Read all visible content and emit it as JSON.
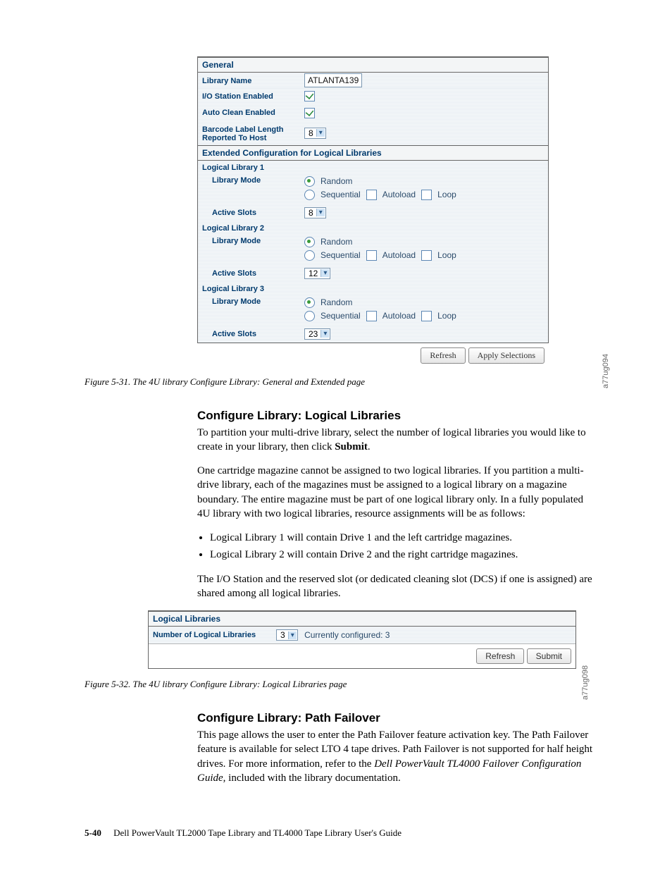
{
  "fig1": {
    "section_general": "General",
    "library_name_lbl": "Library Name",
    "library_name_val": "ATLANTA139",
    "io_station_lbl": "I/O Station Enabled",
    "autoclean_lbl": "Auto Clean Enabled",
    "barcode_lbl": "Barcode Label Length Reported To Host",
    "barcode_val": "8",
    "section_ext": "Extended Configuration for Logical Libraries",
    "lib_hdr_prefix": "Logical Library",
    "mode_lbl": "Library Mode",
    "active_lbl": "Active Slots",
    "opt_random": "Random",
    "opt_seq": "Sequential",
    "opt_autoload": "Autoload",
    "opt_loop": "Loop",
    "libs": [
      {
        "n": "1",
        "slots": "8"
      },
      {
        "n": "2",
        "slots": "12"
      },
      {
        "n": "3",
        "slots": "23"
      }
    ],
    "btn_refresh": "Refresh",
    "btn_apply": "Apply Selections",
    "side": "a77ug094"
  },
  "caption1": "Figure 5-31. The 4U library Configure Library: General and Extended page",
  "sec_logical": {
    "h": "Configure Library: Logical Libraries",
    "p1a": "To partition your multi-drive library, select the number of logical libraries you would like to create in your library, then click ",
    "p1b": "Submit",
    "p1c": ".",
    "p2": "One cartridge magazine cannot be assigned to two logical libraries. If you partition a multi-drive library, each of the magazines must be assigned to a logical library on a magazine boundary. The entire magazine must be part of one logical library only. In a fully populated 4U library with two logical libraries, resource assignments will be as follows:",
    "li1": "Logical Library 1 will contain Drive 1 and the left cartridge magazines.",
    "li2": "Logical Library 2 will contain Drive 2 and the right cartridge magazines.",
    "p3": "The I/O Station and the reserved slot (or dedicated cleaning slot (DCS) if one is assigned) are shared among all logical libraries."
  },
  "fig2": {
    "section": "Logical Libraries",
    "num_lbl": "Number of Logical Libraries",
    "num_val": "3",
    "current": "Currently configured: 3",
    "btn_refresh": "Refresh",
    "btn_submit": "Submit",
    "side": "a77ug098"
  },
  "caption2": "Figure 5-32. The 4U library Configure Library: Logical Libraries page",
  "sec_path": {
    "h": "Configure Library: Path Failover",
    "p1a": "This page allows the user to enter the Path Failover feature activation key. The Path Failover feature is available for select LTO 4 tape drives. Path Failover is not supported for half height drives. For more information, refer to the ",
    "p1b": "Dell PowerVault TL4000 Failover Configuration Guide",
    "p1c": ", included with the library documentation."
  },
  "footer": {
    "page": "5-40",
    "title": "Dell PowerVault TL2000 Tape Library and TL4000 Tape Library User's Guide"
  }
}
